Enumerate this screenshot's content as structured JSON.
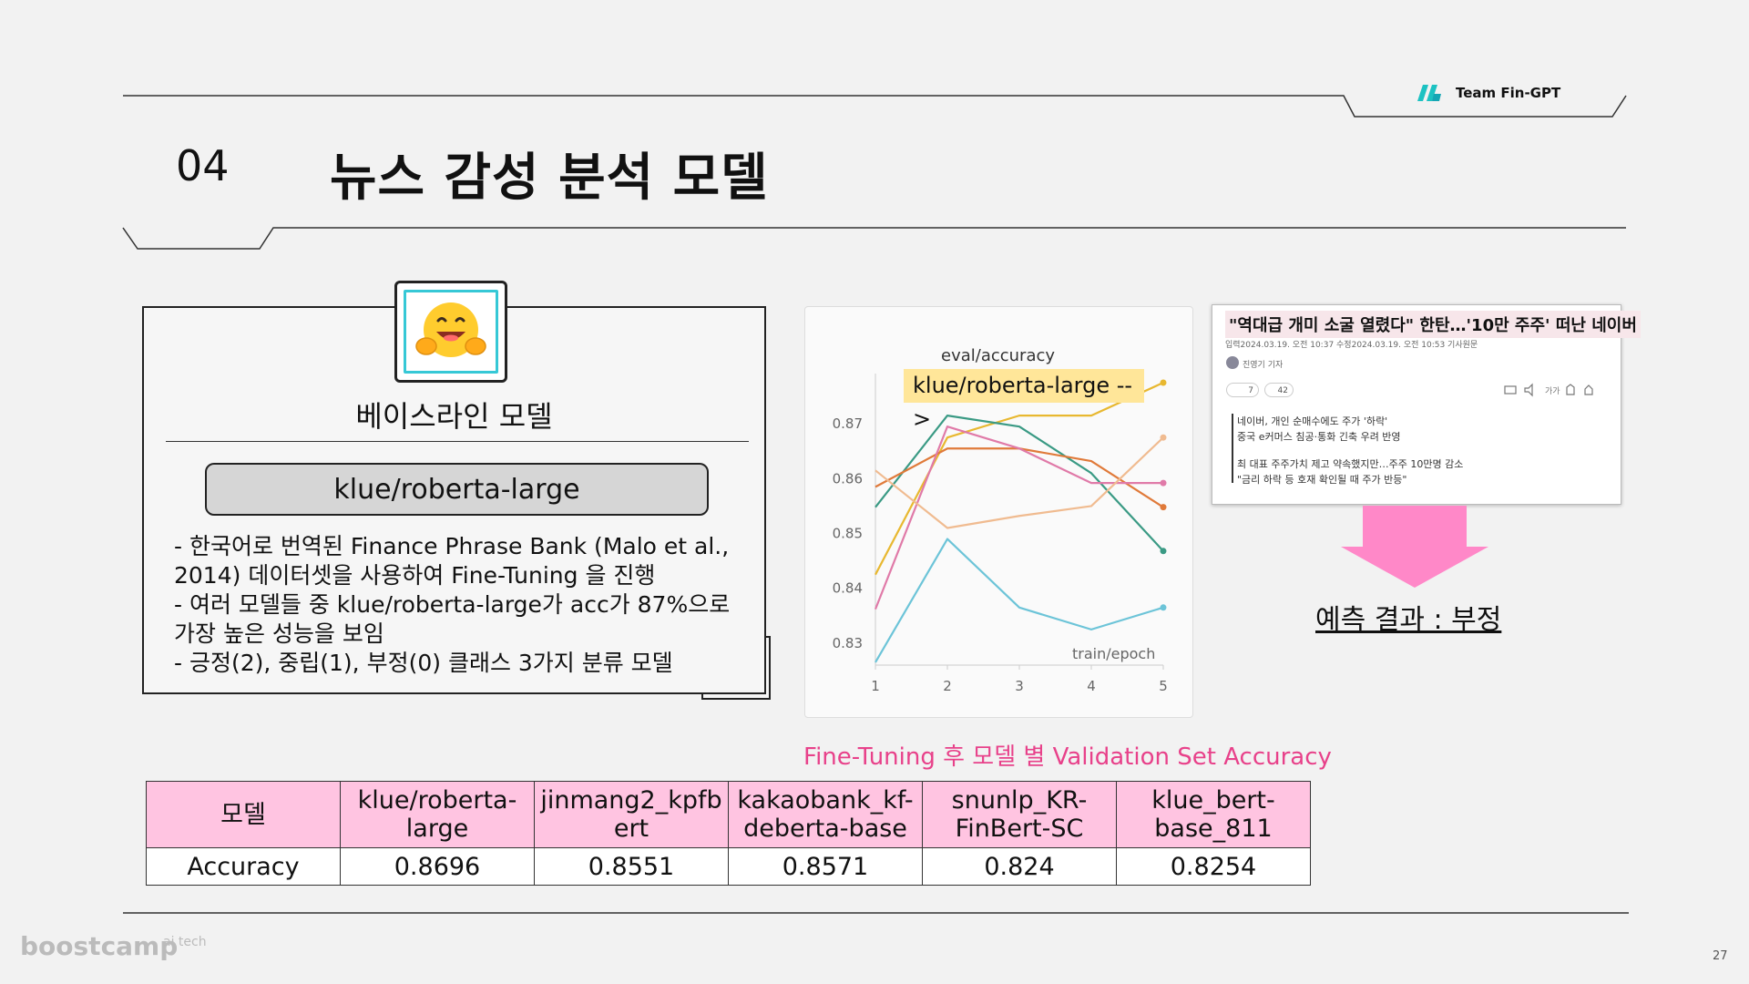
{
  "header": {
    "section_number": "04",
    "title": "뉴스 감성 분석 모델",
    "team": "Team Fin-GPT"
  },
  "baseline": {
    "label": "베이스라인 모델",
    "model_name": "klue/roberta-large",
    "icon": "hugging-face-emoji",
    "description": [
      "- 한국어로 번역된 Finance Phrase Bank (Malo et al.,",
      "2014) 데이터셋을 사용하여 Fine-Tuning 을 진행",
      "- 여러 모델들 중 klue/roberta-large가 acc가 87%으로",
      "가장 높은 성능을 보임",
      "- 긍정(2), 중립(1), 부정(0) 클래스 3가지 분류 모델"
    ]
  },
  "chart_data": {
    "type": "line",
    "title": "eval/accuracy",
    "callout": "klue/roberta-large -->",
    "xlabel": "train/epoch",
    "ylabel": "",
    "x": [
      1,
      2,
      3,
      4,
      5
    ],
    "xlim": [
      1,
      5
    ],
    "ylim": [
      0.826,
      0.8775
    ],
    "yticks": [
      0.83,
      0.84,
      0.85,
      0.86,
      0.87
    ],
    "xticks": [
      1,
      2,
      3,
      4,
      5
    ],
    "grid": false,
    "legend": "none",
    "series": [
      {
        "color": "#e8b830",
        "values": [
          0.8425,
          0.8675,
          0.8715,
          0.8715,
          0.8775
        ]
      },
      {
        "color": "#3a9a84",
        "values": [
          0.8548,
          0.8715,
          0.8695,
          0.861,
          0.8468
        ]
      },
      {
        "color": "#e07a3a",
        "values": [
          0.8585,
          0.8655,
          0.8655,
          0.8632,
          0.8548
        ]
      },
      {
        "color": "#e07aa8",
        "values": [
          0.8362,
          0.8695,
          0.8655,
          0.8592,
          0.8592
        ]
      },
      {
        "color": "#f0bb90",
        "values": [
          0.8615,
          0.851,
          0.8532,
          0.855,
          0.8675
        ]
      },
      {
        "color": "#6cc4d8",
        "values": [
          0.8265,
          0.849,
          0.8365,
          0.8325,
          0.8365
        ]
      }
    ]
  },
  "news": {
    "headline": "\"역대급 개미 소굴 열렸다\" 한탄…'10만 주주' 떠난 네이버",
    "meta": "입력2024.03.19. 오전 10:37   수정2024.03.19. 오전 10:53   기사원문",
    "reporter": "진영기 기자",
    "reactions": [
      "7",
      "42"
    ],
    "summary_lines": [
      "네이버, 개인 순매수에도 주가 '하락'",
      "중국 e커머스 침공·통화 긴축 우려 반영",
      "",
      "최 대표 주주가치 제고 약속했지만…주주 10만명 감소",
      "\"금리 하락 등 호재 확인될 때 주가 반등\""
    ]
  },
  "prediction": "예측 결과 : 부정",
  "table_caption": "Fine-Tuning 후 모델 별 Validation Set Accuracy",
  "table": {
    "header_label": "모델",
    "row_label": "Accuracy",
    "models": [
      [
        "klue/roberta-",
        "large"
      ],
      [
        "jinmang2_kpfb",
        "ert"
      ],
      [
        "kakaobank_kf-",
        "deberta-base"
      ],
      [
        "snunlp_KR-",
        "FinBert-SC"
      ],
      [
        "klue_bert-",
        "base_811"
      ]
    ],
    "values": [
      "0.8696",
      "0.8551",
      "0.8571",
      "0.824",
      "0.8254"
    ]
  },
  "footer": {
    "brand": "boostcamp",
    "brand_suffix": "ai tech",
    "page": "27"
  },
  "colors": {
    "accent_pink": "#e8418a",
    "arrow_pink": "#ff88c8",
    "table_header": "#ffc4e1",
    "teal": "#36c8d6",
    "callout_yellow": "#ffe699"
  }
}
